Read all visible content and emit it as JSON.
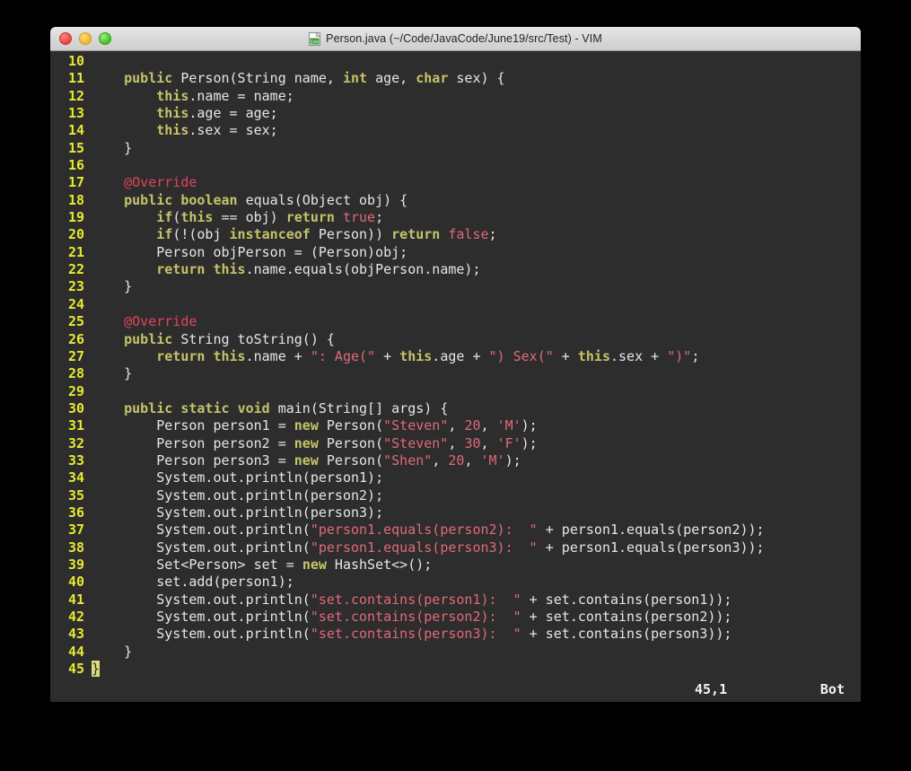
{
  "window": {
    "title": "Person.java (~/Code/JavaCode/June19/src/Test) - VIM",
    "icon": "java-file-icon",
    "controls": {
      "close_label": "close",
      "minimize_label": "minimize",
      "maximize_label": "maximize"
    }
  },
  "theme": {
    "editor_background": "#2d2d2d",
    "desktop_background": "#000000",
    "linenumber_color": "#e8e832",
    "keyword_color": "#c4c46a",
    "string_color": "#e0697a",
    "annotation_color": "#e0445c",
    "plain_text_color": "#e6e6e6",
    "cursor_color": "#dedc7a",
    "titlebar_color": "#d8d8d8"
  },
  "editor": {
    "filetype": "java",
    "first_visible_line": 10,
    "last_visible_line": 45,
    "lines": [
      {
        "num": "10",
        "tokens": []
      },
      {
        "num": "11",
        "tokens": [
          {
            "t": "    ",
            "c": "pln"
          },
          {
            "t": "public",
            "c": "kw"
          },
          {
            "t": " Person(String name, ",
            "c": "pln"
          },
          {
            "t": "int",
            "c": "kw"
          },
          {
            "t": " age, ",
            "c": "pln"
          },
          {
            "t": "char",
            "c": "kw"
          },
          {
            "t": " sex) {",
            "c": "pln"
          }
        ]
      },
      {
        "num": "12",
        "tokens": [
          {
            "t": "        ",
            "c": "pln"
          },
          {
            "t": "this",
            "c": "kw"
          },
          {
            "t": ".name = name;",
            "c": "pln"
          }
        ]
      },
      {
        "num": "13",
        "tokens": [
          {
            "t": "        ",
            "c": "pln"
          },
          {
            "t": "this",
            "c": "kw"
          },
          {
            "t": ".age = age;",
            "c": "pln"
          }
        ]
      },
      {
        "num": "14",
        "tokens": [
          {
            "t": "        ",
            "c": "pln"
          },
          {
            "t": "this",
            "c": "kw"
          },
          {
            "t": ".sex = sex;",
            "c": "pln"
          }
        ]
      },
      {
        "num": "15",
        "tokens": [
          {
            "t": "    }",
            "c": "pln"
          }
        ]
      },
      {
        "num": "16",
        "tokens": []
      },
      {
        "num": "17",
        "tokens": [
          {
            "t": "    ",
            "c": "pln"
          },
          {
            "t": "@Override",
            "c": "ann"
          }
        ]
      },
      {
        "num": "18",
        "tokens": [
          {
            "t": "    ",
            "c": "pln"
          },
          {
            "t": "public",
            "c": "kw"
          },
          {
            "t": " ",
            "c": "pln"
          },
          {
            "t": "boolean",
            "c": "kw"
          },
          {
            "t": " equals(Object obj) {",
            "c": "pln"
          }
        ]
      },
      {
        "num": "19",
        "tokens": [
          {
            "t": "        ",
            "c": "pln"
          },
          {
            "t": "if",
            "c": "kw"
          },
          {
            "t": "(",
            "c": "pln"
          },
          {
            "t": "this",
            "c": "kw"
          },
          {
            "t": " == obj) ",
            "c": "pln"
          },
          {
            "t": "return",
            "c": "kw"
          },
          {
            "t": " ",
            "c": "pln"
          },
          {
            "t": "true",
            "c": "str"
          },
          {
            "t": ";",
            "c": "pln"
          }
        ]
      },
      {
        "num": "20",
        "tokens": [
          {
            "t": "        ",
            "c": "pln"
          },
          {
            "t": "if",
            "c": "kw"
          },
          {
            "t": "(!(obj ",
            "c": "pln"
          },
          {
            "t": "instanceof",
            "c": "kw"
          },
          {
            "t": " Person)) ",
            "c": "pln"
          },
          {
            "t": "return",
            "c": "kw"
          },
          {
            "t": " ",
            "c": "pln"
          },
          {
            "t": "false",
            "c": "str"
          },
          {
            "t": ";",
            "c": "pln"
          }
        ]
      },
      {
        "num": "21",
        "tokens": [
          {
            "t": "        Person objPerson = (Person)obj;",
            "c": "pln"
          }
        ]
      },
      {
        "num": "22",
        "tokens": [
          {
            "t": "        ",
            "c": "pln"
          },
          {
            "t": "return",
            "c": "kw"
          },
          {
            "t": " ",
            "c": "pln"
          },
          {
            "t": "this",
            "c": "kw"
          },
          {
            "t": ".name.equals(objPerson.name);",
            "c": "pln"
          }
        ]
      },
      {
        "num": "23",
        "tokens": [
          {
            "t": "    }",
            "c": "pln"
          }
        ]
      },
      {
        "num": "24",
        "tokens": []
      },
      {
        "num": "25",
        "tokens": [
          {
            "t": "    ",
            "c": "pln"
          },
          {
            "t": "@Override",
            "c": "ann"
          }
        ]
      },
      {
        "num": "26",
        "tokens": [
          {
            "t": "    ",
            "c": "pln"
          },
          {
            "t": "public",
            "c": "kw"
          },
          {
            "t": " String toString() {",
            "c": "pln"
          }
        ]
      },
      {
        "num": "27",
        "tokens": [
          {
            "t": "        ",
            "c": "pln"
          },
          {
            "t": "return",
            "c": "kw"
          },
          {
            "t": " ",
            "c": "pln"
          },
          {
            "t": "this",
            "c": "kw"
          },
          {
            "t": ".name + ",
            "c": "pln"
          },
          {
            "t": "\": Age(\"",
            "c": "str"
          },
          {
            "t": " + ",
            "c": "pln"
          },
          {
            "t": "this",
            "c": "kw"
          },
          {
            "t": ".age + ",
            "c": "pln"
          },
          {
            "t": "\") Sex(\"",
            "c": "str"
          },
          {
            "t": " + ",
            "c": "pln"
          },
          {
            "t": "this",
            "c": "kw"
          },
          {
            "t": ".sex + ",
            "c": "pln"
          },
          {
            "t": "\")\"",
            "c": "str"
          },
          {
            "t": ";",
            "c": "pln"
          }
        ]
      },
      {
        "num": "28",
        "tokens": [
          {
            "t": "    }",
            "c": "pln"
          }
        ]
      },
      {
        "num": "29",
        "tokens": []
      },
      {
        "num": "30",
        "tokens": [
          {
            "t": "    ",
            "c": "pln"
          },
          {
            "t": "public",
            "c": "kw"
          },
          {
            "t": " ",
            "c": "pln"
          },
          {
            "t": "static",
            "c": "kw"
          },
          {
            "t": " ",
            "c": "pln"
          },
          {
            "t": "void",
            "c": "kw"
          },
          {
            "t": " main(String[] args) {",
            "c": "pln"
          }
        ]
      },
      {
        "num": "31",
        "tokens": [
          {
            "t": "        Person person1 = ",
            "c": "pln"
          },
          {
            "t": "new",
            "c": "kw"
          },
          {
            "t": " Person(",
            "c": "pln"
          },
          {
            "t": "\"Steven\"",
            "c": "str"
          },
          {
            "t": ", ",
            "c": "pln"
          },
          {
            "t": "20",
            "c": "str"
          },
          {
            "t": ", ",
            "c": "pln"
          },
          {
            "t": "'M'",
            "c": "str"
          },
          {
            "t": ");",
            "c": "pln"
          }
        ]
      },
      {
        "num": "32",
        "tokens": [
          {
            "t": "        Person person2 = ",
            "c": "pln"
          },
          {
            "t": "new",
            "c": "kw"
          },
          {
            "t": " Person(",
            "c": "pln"
          },
          {
            "t": "\"Steven\"",
            "c": "str"
          },
          {
            "t": ", ",
            "c": "pln"
          },
          {
            "t": "30",
            "c": "str"
          },
          {
            "t": ", ",
            "c": "pln"
          },
          {
            "t": "'F'",
            "c": "str"
          },
          {
            "t": ");",
            "c": "pln"
          }
        ]
      },
      {
        "num": "33",
        "tokens": [
          {
            "t": "        Person person3 = ",
            "c": "pln"
          },
          {
            "t": "new",
            "c": "kw"
          },
          {
            "t": " Person(",
            "c": "pln"
          },
          {
            "t": "\"Shen\"",
            "c": "str"
          },
          {
            "t": ", ",
            "c": "pln"
          },
          {
            "t": "20",
            "c": "str"
          },
          {
            "t": ", ",
            "c": "pln"
          },
          {
            "t": "'M'",
            "c": "str"
          },
          {
            "t": ");",
            "c": "pln"
          }
        ]
      },
      {
        "num": "34",
        "tokens": [
          {
            "t": "        System.out.println(person1);",
            "c": "pln"
          }
        ]
      },
      {
        "num": "35",
        "tokens": [
          {
            "t": "        System.out.println(person2);",
            "c": "pln"
          }
        ]
      },
      {
        "num": "36",
        "tokens": [
          {
            "t": "        System.out.println(person3);",
            "c": "pln"
          }
        ]
      },
      {
        "num": "37",
        "tokens": [
          {
            "t": "        System.out.println(",
            "c": "pln"
          },
          {
            "t": "\"person1.equals(person2):  \"",
            "c": "str"
          },
          {
            "t": " + person1.equals(person2));",
            "c": "pln"
          }
        ]
      },
      {
        "num": "38",
        "tokens": [
          {
            "t": "        System.out.println(",
            "c": "pln"
          },
          {
            "t": "\"person1.equals(person3):  \"",
            "c": "str"
          },
          {
            "t": " + person1.equals(person3));",
            "c": "pln"
          }
        ]
      },
      {
        "num": "39",
        "tokens": [
          {
            "t": "        Set<Person> set = ",
            "c": "pln"
          },
          {
            "t": "new",
            "c": "kw"
          },
          {
            "t": " HashSet<>();",
            "c": "pln"
          }
        ]
      },
      {
        "num": "40",
        "tokens": [
          {
            "t": "        set.add(person1);",
            "c": "pln"
          }
        ]
      },
      {
        "num": "41",
        "tokens": [
          {
            "t": "        System.out.println(",
            "c": "pln"
          },
          {
            "t": "\"set.contains(person1):  \"",
            "c": "str"
          },
          {
            "t": " + set.contains(person1));",
            "c": "pln"
          }
        ]
      },
      {
        "num": "42",
        "tokens": [
          {
            "t": "        System.out.println(",
            "c": "pln"
          },
          {
            "t": "\"set.contains(person2):  \"",
            "c": "str"
          },
          {
            "t": " + set.contains(person2));",
            "c": "pln"
          }
        ]
      },
      {
        "num": "43",
        "tokens": [
          {
            "t": "        System.out.println(",
            "c": "pln"
          },
          {
            "t": "\"set.contains(person3):  \"",
            "c": "str"
          },
          {
            "t": " + set.contains(person3));",
            "c": "pln"
          }
        ]
      },
      {
        "num": "44",
        "tokens": [
          {
            "t": "    }",
            "c": "pln"
          }
        ]
      },
      {
        "num": "45",
        "tokens": [
          {
            "t": "}",
            "c": "cursor"
          }
        ]
      }
    ]
  },
  "statusline": {
    "position": "45,1",
    "scroll": "Bot"
  }
}
